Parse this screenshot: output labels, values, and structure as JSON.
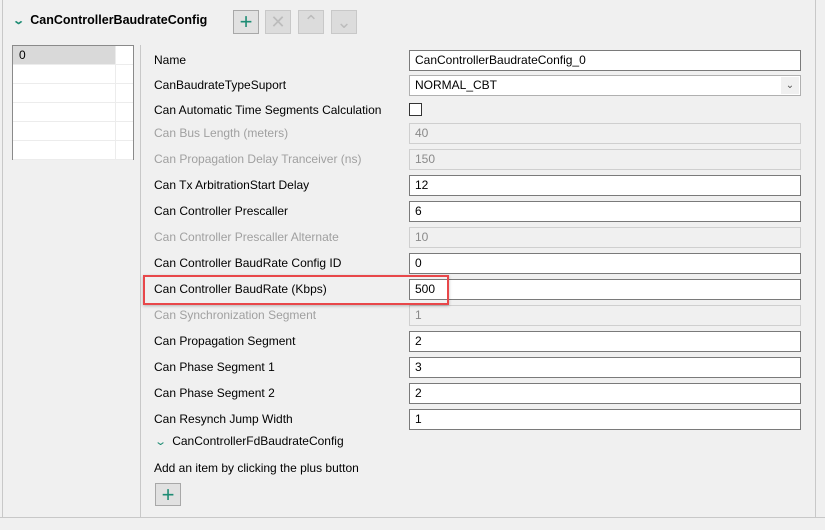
{
  "section": {
    "title": "CanControllerBaudrateConfig",
    "toolbar": {
      "add": "+",
      "remove": "✕",
      "up": "⌃",
      "down": "⌄"
    }
  },
  "list": {
    "items": [
      "0",
      "",
      "",
      "",
      "",
      ""
    ]
  },
  "fields": [
    {
      "label": "Name",
      "value": "CanControllerBaudrateConfig_0",
      "type": "text",
      "disabled": false
    },
    {
      "label": "CanBaudrateTypeSuport",
      "value": "NORMAL_CBT",
      "type": "select",
      "disabled": false
    },
    {
      "label": "Can Automatic Time Segments Calculation",
      "value": "",
      "type": "checkbox",
      "checked": false,
      "disabled": false
    },
    {
      "label": "Can Bus Length (meters)",
      "value": "40",
      "type": "text",
      "disabled": true
    },
    {
      "label": "Can Propagation Delay Tranceiver (ns)",
      "value": "150",
      "type": "text",
      "disabled": true
    },
    {
      "label": "Can Tx ArbitrationStart Delay",
      "value": "12",
      "type": "text",
      "disabled": false
    },
    {
      "label": "Can Controller Prescaller",
      "value": "6",
      "type": "text",
      "disabled": false
    },
    {
      "label": "Can Controller Prescaller Alternate",
      "value": "10",
      "type": "text",
      "disabled": true
    },
    {
      "label": "Can Controller BaudRate Config ID",
      "value": "0",
      "type": "text",
      "disabled": false
    },
    {
      "label": "Can Controller BaudRate (Kbps)",
      "value": "500",
      "type": "text",
      "disabled": false
    },
    {
      "label": "Can Synchronization Segment",
      "value": "1",
      "type": "text",
      "disabled": true
    },
    {
      "label": "Can Propagation Segment",
      "value": "2",
      "type": "text",
      "disabled": false
    },
    {
      "label": "Can Phase Segment 1",
      "value": "3",
      "type": "text",
      "disabled": false
    },
    {
      "label": "Can Phase Segment 2",
      "value": "2",
      "type": "text",
      "disabled": false
    },
    {
      "label": "Can Resynch Jump Width",
      "value": "1",
      "type": "text",
      "disabled": false
    }
  ],
  "subsection": {
    "title": "CanControllerFdBaudrateConfig",
    "hint": "Add an item by clicking the plus button",
    "add": "+"
  },
  "colors": {
    "accent": "#1e8c74",
    "highlight": "#e8474a"
  }
}
